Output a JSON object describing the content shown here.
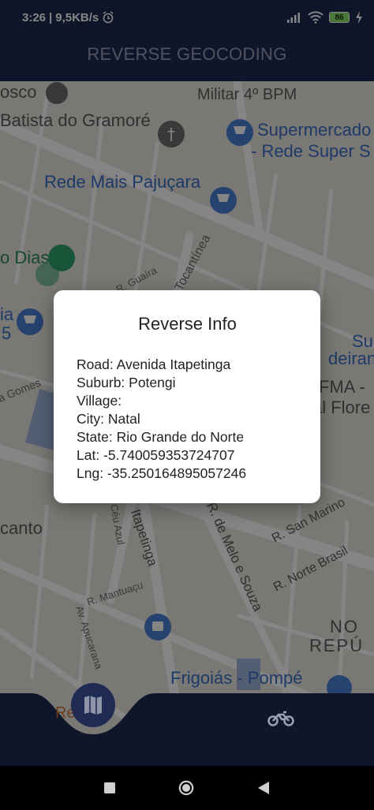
{
  "status_bar": {
    "time": "3:26",
    "speed": "9,5KB/s",
    "battery": "86"
  },
  "app_bar": {
    "title": "REVERSE GEOCODING"
  },
  "map": {
    "labels": {
      "osco": "osco",
      "militar": "Militar 4º BPM",
      "batista": "Batista do Gramoré",
      "supermercado_1": "Supermercado",
      "supermercado_2": "- Rede Super S",
      "rede_mais": "Rede Mais Pajuçara",
      "dias": "o Dias",
      "tocantinea": "Tocantínea",
      "guaira": "R. Guaíra",
      "gomes": "a Gomes",
      "ia": "ia",
      "five": "5",
      "su": "Su",
      "deirant": "deirant",
      "fma": "FMA -",
      "flore": "al Flore",
      "canto": "canto",
      "itapetinga": "Itapetinga",
      "ceu_azul": "Céu Azul",
      "melo_souza": "R. de Melo e Souza",
      "san_marino": "R. San Marino",
      "norte_brasil": "R. Norte Brasil",
      "mantuacu": "R. Mantuaçu",
      "apucarana": "Av. Apucarana",
      "no": "NO",
      "repu": "REPÚ",
      "frigoias": "Frigoiás - Pompé"
    }
  },
  "dialog": {
    "title": "Reverse Info",
    "road": "Road: Avenida Itapetinga",
    "suburb": "Suburb: Potengi",
    "village": "Village:",
    "city": "City: Natal",
    "state": "State: Rio Grande do Norte",
    "lat": "Lat: -5.740059353724707",
    "lng": "Lng: -35.250164895057246"
  },
  "bottom_nav": {
    "active_label": "Re      E",
    "items": [
      {
        "icon": "map-icon"
      },
      {
        "icon": "motorcycle-icon"
      }
    ]
  },
  "colors": {
    "primary": "#1f2b52",
    "map_pin_blue": "#4a7fd4",
    "map_pin_green": "#2fa36b",
    "battery": "#8fe36a"
  }
}
